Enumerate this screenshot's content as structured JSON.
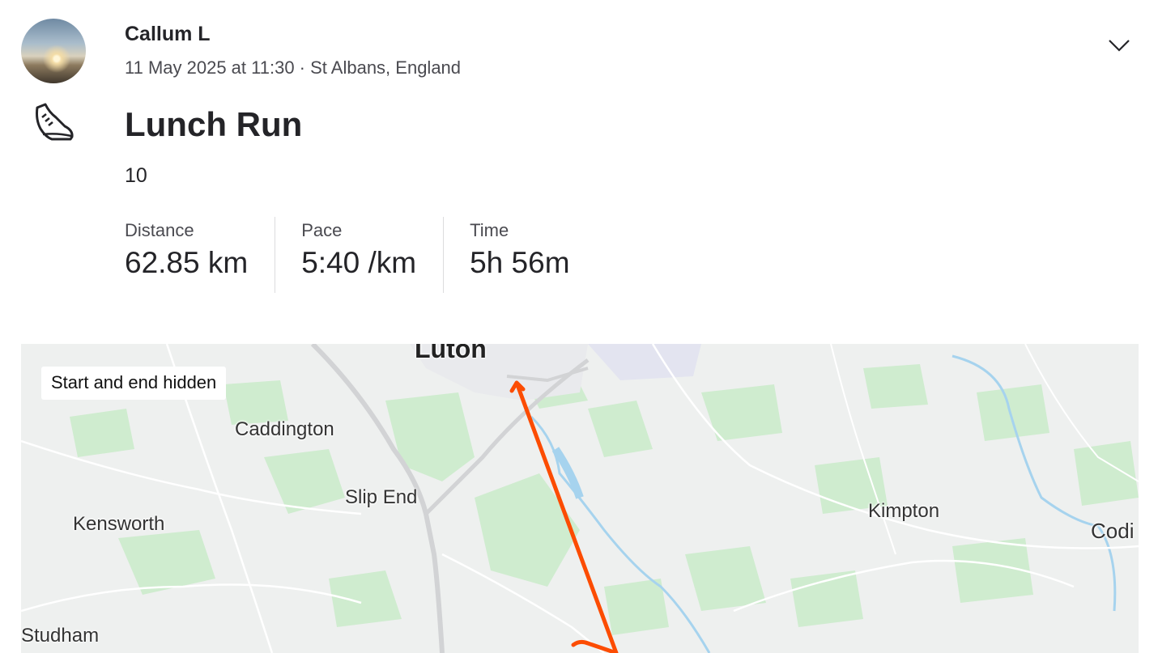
{
  "athlete": {
    "name": "Callum L",
    "datetime_location": "11 May 2025 at 11:30 · St Albans, England"
  },
  "activity": {
    "sport_icon": "running-shoe-icon",
    "title": "Lunch Run",
    "description": "10"
  },
  "stats": [
    {
      "label": "Distance",
      "value": "62.85 km"
    },
    {
      "label": "Pace",
      "value": "5:40 /km"
    },
    {
      "label": "Time",
      "value": "5h 56m"
    }
  ],
  "map": {
    "privacy_badge": "Start and end hidden",
    "places": [
      "Luton",
      "Caddington",
      "Slip End",
      "Kensworth",
      "Kimpton",
      "Codi",
      "Studham"
    ],
    "route_color": "#fc4c02",
    "park_color": "#cfeccf",
    "water_color": "#a6d3ee"
  },
  "header": {
    "menu_icon": "chevron-down-icon"
  }
}
